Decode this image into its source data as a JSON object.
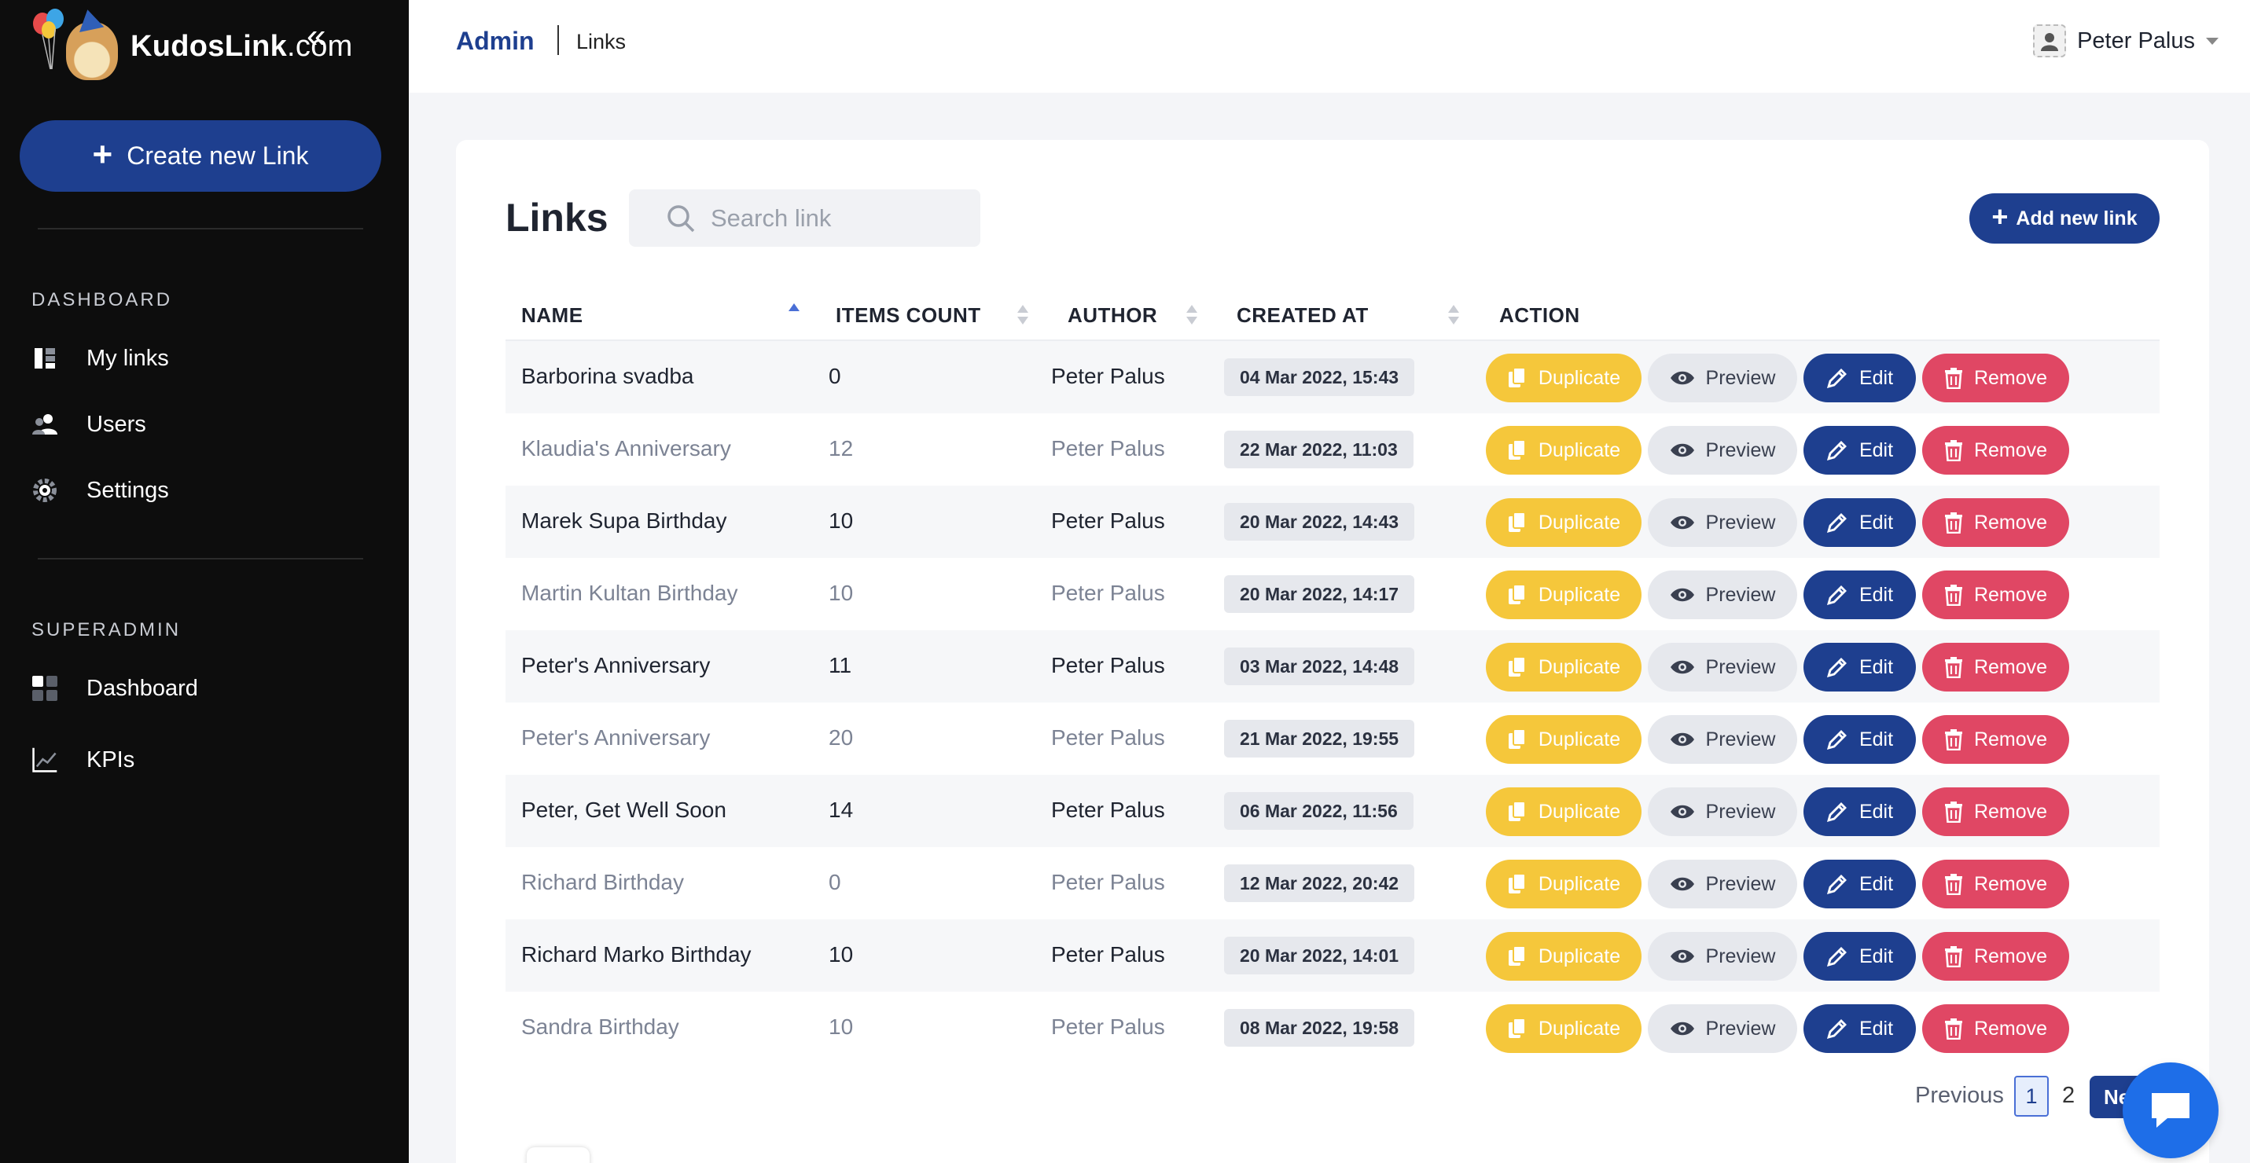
{
  "sidebar": {
    "brand_name": "KudosLink",
    "brand_suffix": ".com",
    "create_button": "Create new Link",
    "dashboard_title": "DASHBOARD",
    "dashboard_items": [
      {
        "label": "My links",
        "icon": "list-icon"
      },
      {
        "label": "Users",
        "icon": "users-icon"
      },
      {
        "label": "Settings",
        "icon": "gear-icon"
      }
    ],
    "superadmin_title": "SUPERADMIN",
    "superadmin_items": [
      {
        "label": "Dashboard",
        "icon": "grid-icon"
      },
      {
        "label": "KPIs",
        "icon": "chart-icon"
      }
    ]
  },
  "header": {
    "breadcrumb_root": "Admin",
    "breadcrumb_current": "Links",
    "user_name": "Peter Palus"
  },
  "main": {
    "title": "Links",
    "search_placeholder": "Search link",
    "add_button": "Add new link",
    "columns": [
      "NAME",
      "ITEMS COUNT",
      "AUTHOR",
      "CREATED AT",
      "ACTION"
    ],
    "action_labels": {
      "duplicate": "Duplicate",
      "preview": "Preview",
      "edit": "Edit",
      "remove": "Remove"
    },
    "rows": [
      {
        "name": "Barborina svadba",
        "count": "0",
        "author": "Peter Palus",
        "created": "04 Mar 2022, 15:43"
      },
      {
        "name": "Klaudia's Anniversary",
        "count": "12",
        "author": "Peter Palus",
        "created": "22 Mar 2022, 11:03"
      },
      {
        "name": "Marek Supa Birthday",
        "count": "10",
        "author": "Peter Palus",
        "created": "20 Mar 2022, 14:43"
      },
      {
        "name": "Martin Kultan Birthday",
        "count": "10",
        "author": "Peter Palus",
        "created": "20 Mar 2022, 14:17"
      },
      {
        "name": "Peter's Anniversary",
        "count": "11",
        "author": "Peter Palus",
        "created": "03 Mar 2022, 14:48"
      },
      {
        "name": "Peter's Anniversary",
        "count": "20",
        "author": "Peter Palus",
        "created": "21 Mar 2022, 19:55"
      },
      {
        "name": "Peter, Get Well Soon",
        "count": "14",
        "author": "Peter Palus",
        "created": "06 Mar 2022, 11:56"
      },
      {
        "name": "Richard Birthday",
        "count": "0",
        "author": "Peter Palus",
        "created": "12 Mar 2022, 20:42"
      },
      {
        "name": "Richard Marko Birthday",
        "count": "10",
        "author": "Peter Palus",
        "created": "20 Mar 2022, 14:01"
      },
      {
        "name": "Sandra Birthday",
        "count": "10",
        "author": "Peter Palus",
        "created": "08 Mar 2022, 19:58"
      }
    ],
    "pagination": {
      "previous": "Previous",
      "page1": "1",
      "page2": "2",
      "next": "Next"
    }
  },
  "colors": {
    "accent": "#1e3f8f",
    "duplicate": "#f5c73b",
    "remove": "#e04764",
    "preview": "#e6e8ed",
    "sidebar": "#0d0d0d"
  }
}
